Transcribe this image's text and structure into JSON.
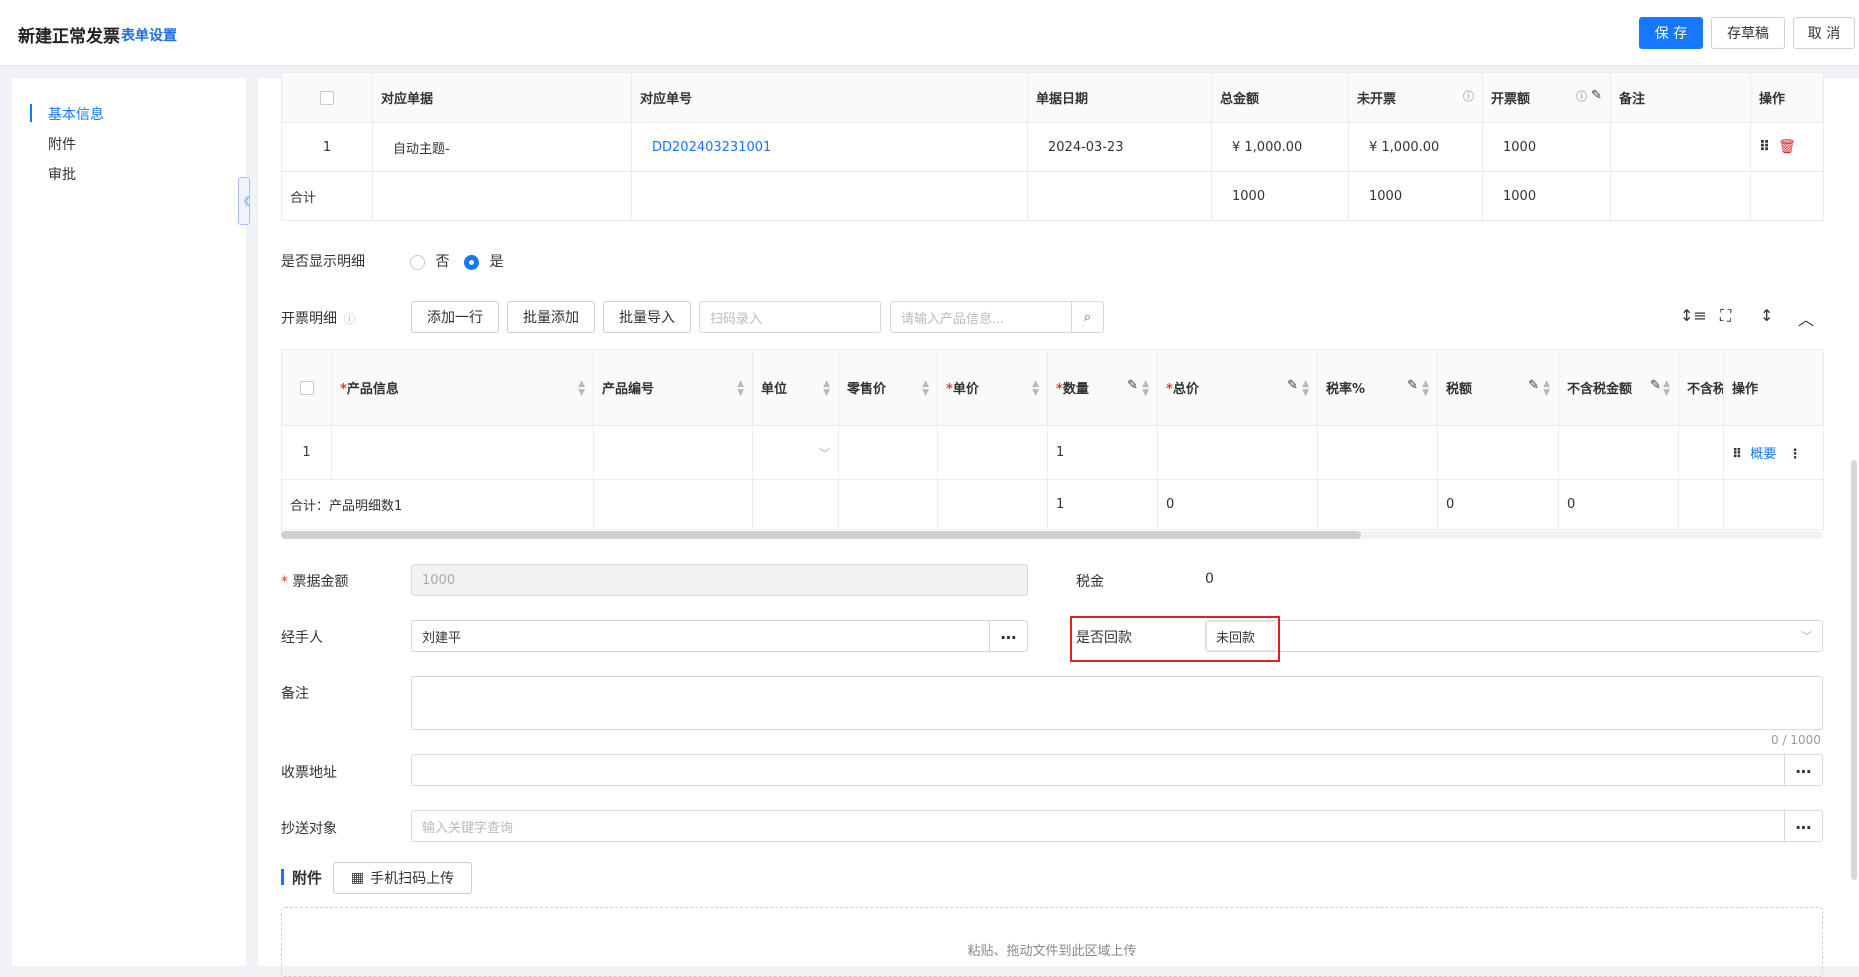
{
  "header": {
    "title": "新建正常发票",
    "form_settings": "表单设置",
    "save": "保 存",
    "draft": "存草稿",
    "cancel": "取 消"
  },
  "sidebar": {
    "items": [
      {
        "label": "基本信息",
        "active": true
      },
      {
        "label": "附件",
        "active": false
      },
      {
        "label": "审批",
        "active": false
      }
    ],
    "collapse_glyph": "《"
  },
  "source_table": {
    "headers": [
      "对应单据",
      "对应单号",
      "单据日期",
      "总金额",
      "未开票",
      "开票额",
      "备注",
      "操作"
    ],
    "row": {
      "index": "1",
      "doc": "自动主题-",
      "doc_no": "DD202403231001",
      "date": "2024-03-23",
      "total": "¥ 1,000.00",
      "uninvoiced": "¥ 1,000.00",
      "invoice_amount": "1000",
      "remark": ""
    },
    "sum_label": "合计",
    "sum": {
      "total": "1000",
      "uninvoiced": "1000",
      "invoice_amount": "1000"
    }
  },
  "show_detail": {
    "label": "是否显示明细",
    "option_no": "否",
    "option_yes": "是",
    "selected": "是"
  },
  "detail_toolbar": {
    "label": "开票明细",
    "add_row": "添加一行",
    "batch_add": "批量添加",
    "batch_import": "批量导入",
    "scan_placeholder": "扫码录入",
    "search_placeholder": "请输入产品信息..."
  },
  "detail_table": {
    "headers": [
      "产品信息",
      "产品编号",
      "单位",
      "零售价",
      "单价",
      "数量",
      "总价",
      "税率%",
      "税额",
      "不含税金额",
      "不含税",
      "操作"
    ],
    "required": [
      "产品信息",
      "单价",
      "数量",
      "总价"
    ],
    "row": {
      "index": "1",
      "quantity": "1",
      "summary_link": "概要"
    },
    "sum_label": "合计：产品明细数1",
    "sum": {
      "quantity": "1",
      "total": "0",
      "tax": "0",
      "net": "0"
    }
  },
  "form": {
    "amount_label": "票据金额",
    "amount_value": "1000",
    "tax_label": "税金",
    "tax_value": "0",
    "handler_label": "经手人",
    "handler_value": "刘建平",
    "repaid_label": "是否回款",
    "repaid_value": "未回款",
    "remark_label": "备注",
    "remark_counter": "0 / 1000",
    "address_label": "收票地址",
    "cc_label": "抄送对象",
    "cc_placeholder": "输入关键字查询"
  },
  "attachment": {
    "title": "附件",
    "mobile_upload": "手机扫码上传",
    "dropzone_text": "粘贴、拖动文件到此区域上传"
  },
  "colors": {
    "accent": "#1677ff",
    "danger": "#e02020"
  }
}
